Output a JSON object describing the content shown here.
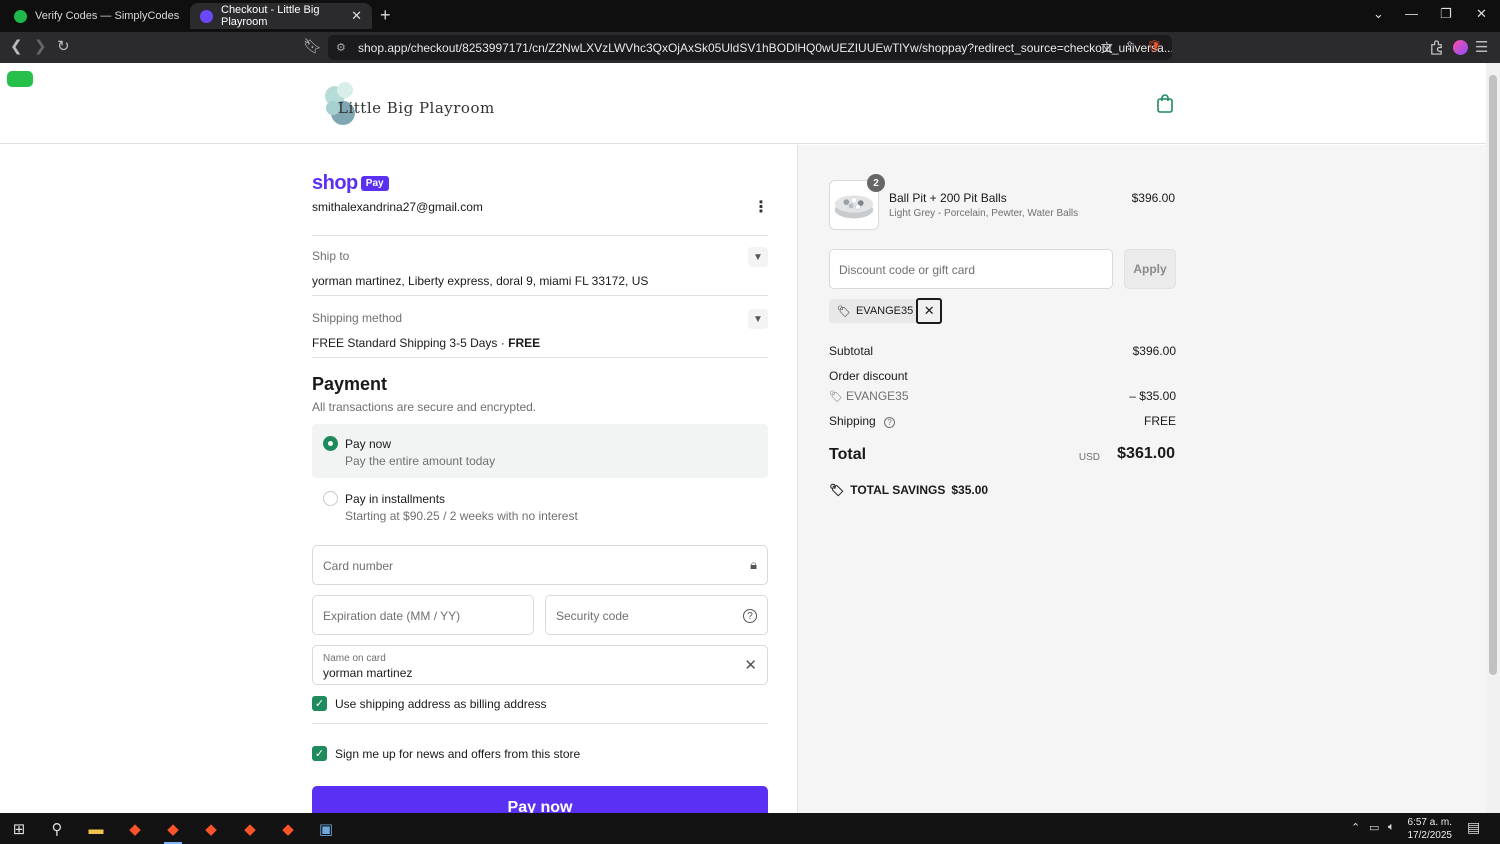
{
  "browser": {
    "tabs": [
      {
        "title": "Verify Codes — SimplyCodes",
        "favicon_color": "#1fb84a"
      },
      {
        "title": "Checkout - Little Big Playroom",
        "favicon_color": "#6b47ff"
      }
    ],
    "url": "shop.app/checkout/8253997171/cn/Z2NwLXVzLWVhc3QxOjAxSk05UldSV1hBODlHQ0wUEZIUUEwTlYw/shoppay?redirect_source=checkout_universa...",
    "new_tab": "+",
    "brave_shield_count": "6"
  },
  "store": {
    "name": "Little Big Playroom"
  },
  "checkout": {
    "shop_label": "shop",
    "pay_badge": "Pay",
    "email": "smithalexandrina27@gmail.com",
    "ship_to_label": "Ship to",
    "ship_to_value": "yorman martinez, Liberty express, doral 9, miami FL 33172, US",
    "shipping_method_label": "Shipping method",
    "shipping_method_value": "FREE Standard Shipping 3-5 Days · ",
    "shipping_method_price": "FREE",
    "payment_title": "Payment",
    "payment_subtitle": "All transactions are secure and encrypted.",
    "options": [
      {
        "title": "Pay now",
        "subtitle": "Pay the entire amount today",
        "selected": true
      },
      {
        "title": "Pay in installments",
        "subtitle": "Starting at $90.25 / 2 weeks with no interest",
        "selected": false
      }
    ],
    "card_number_placeholder": "Card number",
    "expiration_placeholder": "Expiration date (MM / YY)",
    "security_placeholder": "Security code",
    "name_label": "Name on card",
    "name_value": "yorman martinez",
    "billing_checkbox": "Use shipping address as billing address",
    "news_checkbox": "Sign me up for news and offers from this store",
    "pay_button": "Pay now"
  },
  "summary": {
    "product": {
      "name": "Ball Pit + 200 Pit Balls",
      "variant": "Light Grey - Porcelain, Pewter, Water Balls",
      "price": "$396.00",
      "quantity": "2"
    },
    "discount_placeholder": "Discount code or gift card",
    "apply_label": "Apply",
    "applied_code": "EVANGE35",
    "subtotal_label": "Subtotal",
    "subtotal_value": "$396.00",
    "order_discount_label": "Order discount",
    "discount_code": "EVANGE35",
    "discount_value": "– $35.00",
    "shipping_label": "Shipping",
    "shipping_value": "FREE",
    "total_label": "Total",
    "currency": "USD",
    "total_value": "$361.00",
    "savings_label": "TOTAL SAVINGS",
    "savings_value": "$35.00"
  },
  "taskbar": {
    "time": "6:57 a. m.",
    "date": "17/2/2025"
  }
}
